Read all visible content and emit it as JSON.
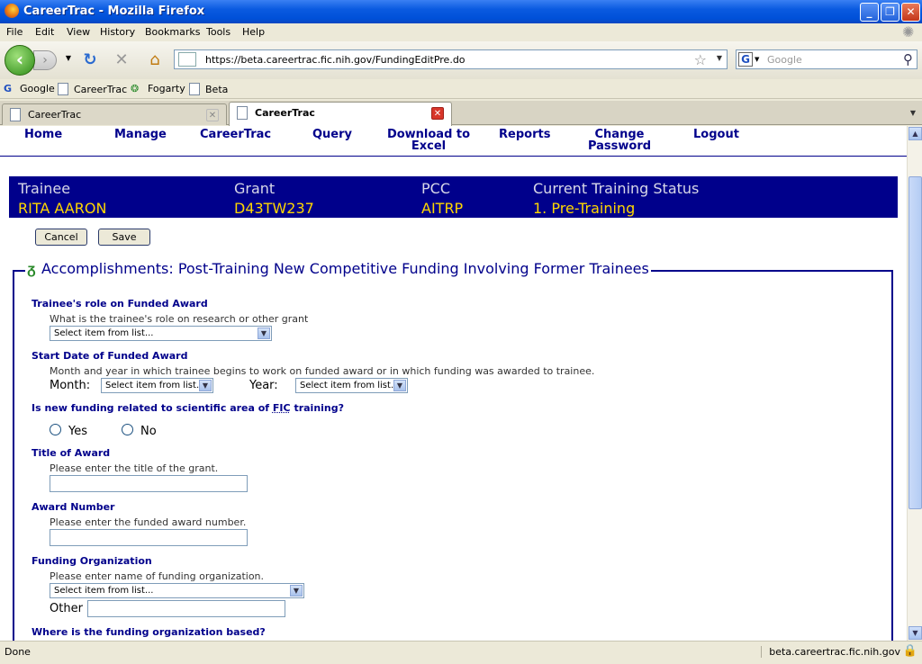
{
  "window": {
    "title": "CareerTrac - Mozilla Firefox",
    "minimize": "_",
    "maximize": "❐",
    "close": "✕"
  },
  "menu": [
    "File",
    "Edit",
    "View",
    "History",
    "Bookmarks",
    "Tools",
    "Help"
  ],
  "nav": {
    "url": "https://beta.careertrac.fic.nih.gov/FundingEditPre.do",
    "search_placeholder": "Google",
    "search_engine": "G"
  },
  "bookmarks": [
    "Google",
    "CareerTrac",
    "Fogarty",
    "Beta"
  ],
  "tabs": [
    {
      "label": "CareerTrac"
    },
    {
      "label": "CareerTrac"
    }
  ],
  "status": {
    "text": "Done",
    "host": "beta.careertrac.fic.nih.gov"
  },
  "appnav": [
    "Home",
    "Manage",
    "CareerTrac",
    "Query",
    "Download to Excel",
    "Reports",
    "Change Password",
    "Logout"
  ],
  "trainee": {
    "labels": {
      "trainee": "Trainee",
      "grant": "Grant",
      "pcc": "PCC",
      "status": "Current Training Status"
    },
    "values": {
      "trainee": "RITA AARON",
      "grant": "D43TW237",
      "pcc": "AITRP",
      "status": "1. Pre-Training"
    }
  },
  "buttons": {
    "cancel": "Cancel",
    "save": "Save"
  },
  "section_title": "Accomplishments: Post-Training New Competitive Funding Involving Former Trainees",
  "form": {
    "role": {
      "label": "Trainee's role on Funded Award",
      "hint": "What is the trainee's role on research or other grant",
      "value": "Select item from list..."
    },
    "start": {
      "label": "Start Date of Funded Award",
      "hint": "Month and year in which trainee begins to work on funded award or in which funding was awarded to trainee.",
      "month_label": "Month:",
      "month_value": "Select item from list...",
      "year_label": "Year:",
      "year_value": "Select item from list..."
    },
    "related": {
      "label_pre": "Is new funding related to scientific area of ",
      "label_abbr": "FIC",
      "label_post": " training?",
      "yes": "Yes",
      "no": "No"
    },
    "title": {
      "label": "Title of Award",
      "hint": "Please enter the title of the grant."
    },
    "number": {
      "label": "Award Number",
      "hint": "Please enter the funded award number."
    },
    "org": {
      "label": "Funding Organization",
      "hint": "Please enter name of funding organization.",
      "value": "Select item from list...",
      "other_label": "Other"
    },
    "based": {
      "label": "Where is the funding organization based?"
    }
  }
}
